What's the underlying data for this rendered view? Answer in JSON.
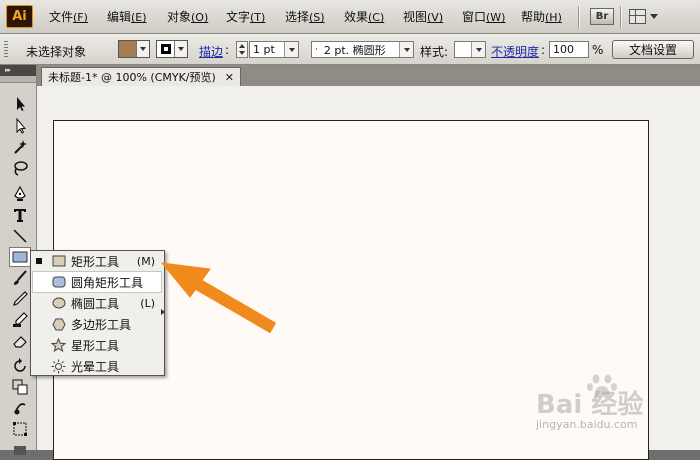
{
  "app": {
    "logo_text": "Ai"
  },
  "menubar": {
    "items": [
      {
        "label": "文件",
        "key": "(F)"
      },
      {
        "label": "编辑",
        "key": "(E)"
      },
      {
        "label": "对象",
        "key": "(O)"
      },
      {
        "label": "文字",
        "key": "(T)"
      },
      {
        "label": "选择",
        "key": "(S)"
      },
      {
        "label": "效果",
        "key": "(C)"
      },
      {
        "label": "视图",
        "key": "(V)"
      },
      {
        "label": "窗口",
        "key": "(W)"
      },
      {
        "label": "帮助",
        "key": "(H)"
      }
    ],
    "bridge_label": "Br"
  },
  "controlbar": {
    "selection_status": "未选择对象",
    "fill_color": "#a67c52",
    "stroke_color": "#000000",
    "stroke_label": "描边",
    "stroke_weight": "1 pt",
    "brush_label": "2 pt. 椭圆形",
    "style_label": "样式:",
    "opacity_label": "不透明度",
    "opacity_value": "100",
    "opacity_unit": "%",
    "doc_settings_button": "文档设置"
  },
  "document": {
    "tab_title": "未标题-1* @ 100% (CMYK/预览)",
    "tab_close": "✕"
  },
  "flyout": {
    "items": [
      {
        "label": "矩形工具",
        "shortcut": "(M)",
        "icon": "rectangle-icon"
      },
      {
        "label": "圆角矩形工具",
        "shortcut": "",
        "icon": "rounded-rectangle-icon"
      },
      {
        "label": "椭圆工具",
        "shortcut": "(L)",
        "icon": "ellipse-icon"
      },
      {
        "label": "多边形工具",
        "shortcut": "",
        "icon": "polygon-icon"
      },
      {
        "label": "星形工具",
        "shortcut": "",
        "icon": "star-icon"
      },
      {
        "label": "光晕工具",
        "shortcut": "",
        "icon": "flare-icon"
      }
    ],
    "selected_index": 1
  },
  "watermark": {
    "brand": "Bai 经验",
    "url": "jingyan.baidu.com"
  },
  "colors": {
    "arrow": "#f08a1c",
    "artboard": "#fffaf5"
  }
}
